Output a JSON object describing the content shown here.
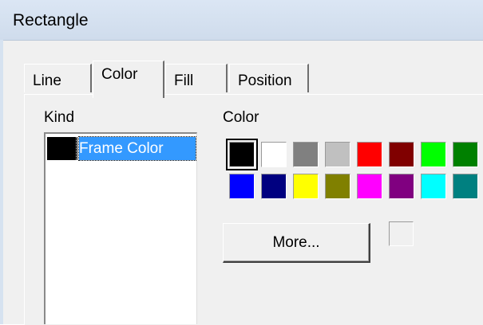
{
  "window": {
    "title": "Rectangle"
  },
  "tabs": [
    {
      "label": "Line",
      "active": false
    },
    {
      "label": "Color",
      "active": true
    },
    {
      "label": "Fill",
      "active": false
    },
    {
      "label": "Position",
      "active": false
    }
  ],
  "kind": {
    "label": "Kind",
    "items": [
      {
        "label": "Frame Color",
        "color": "#000000",
        "selected": true
      }
    ]
  },
  "color": {
    "label": "Color",
    "palette": [
      "#000000",
      "#ffffff",
      "#808080",
      "#c0c0c0",
      "#ff0000",
      "#800000",
      "#00ff00",
      "#008000",
      "#0000ff",
      "#000080",
      "#ffff00",
      "#808000",
      "#ff00ff",
      "#800080",
      "#00ffff",
      "#008080"
    ],
    "selected": "#000000",
    "more_label": "More...",
    "current_preview": "#f0f0f0"
  }
}
